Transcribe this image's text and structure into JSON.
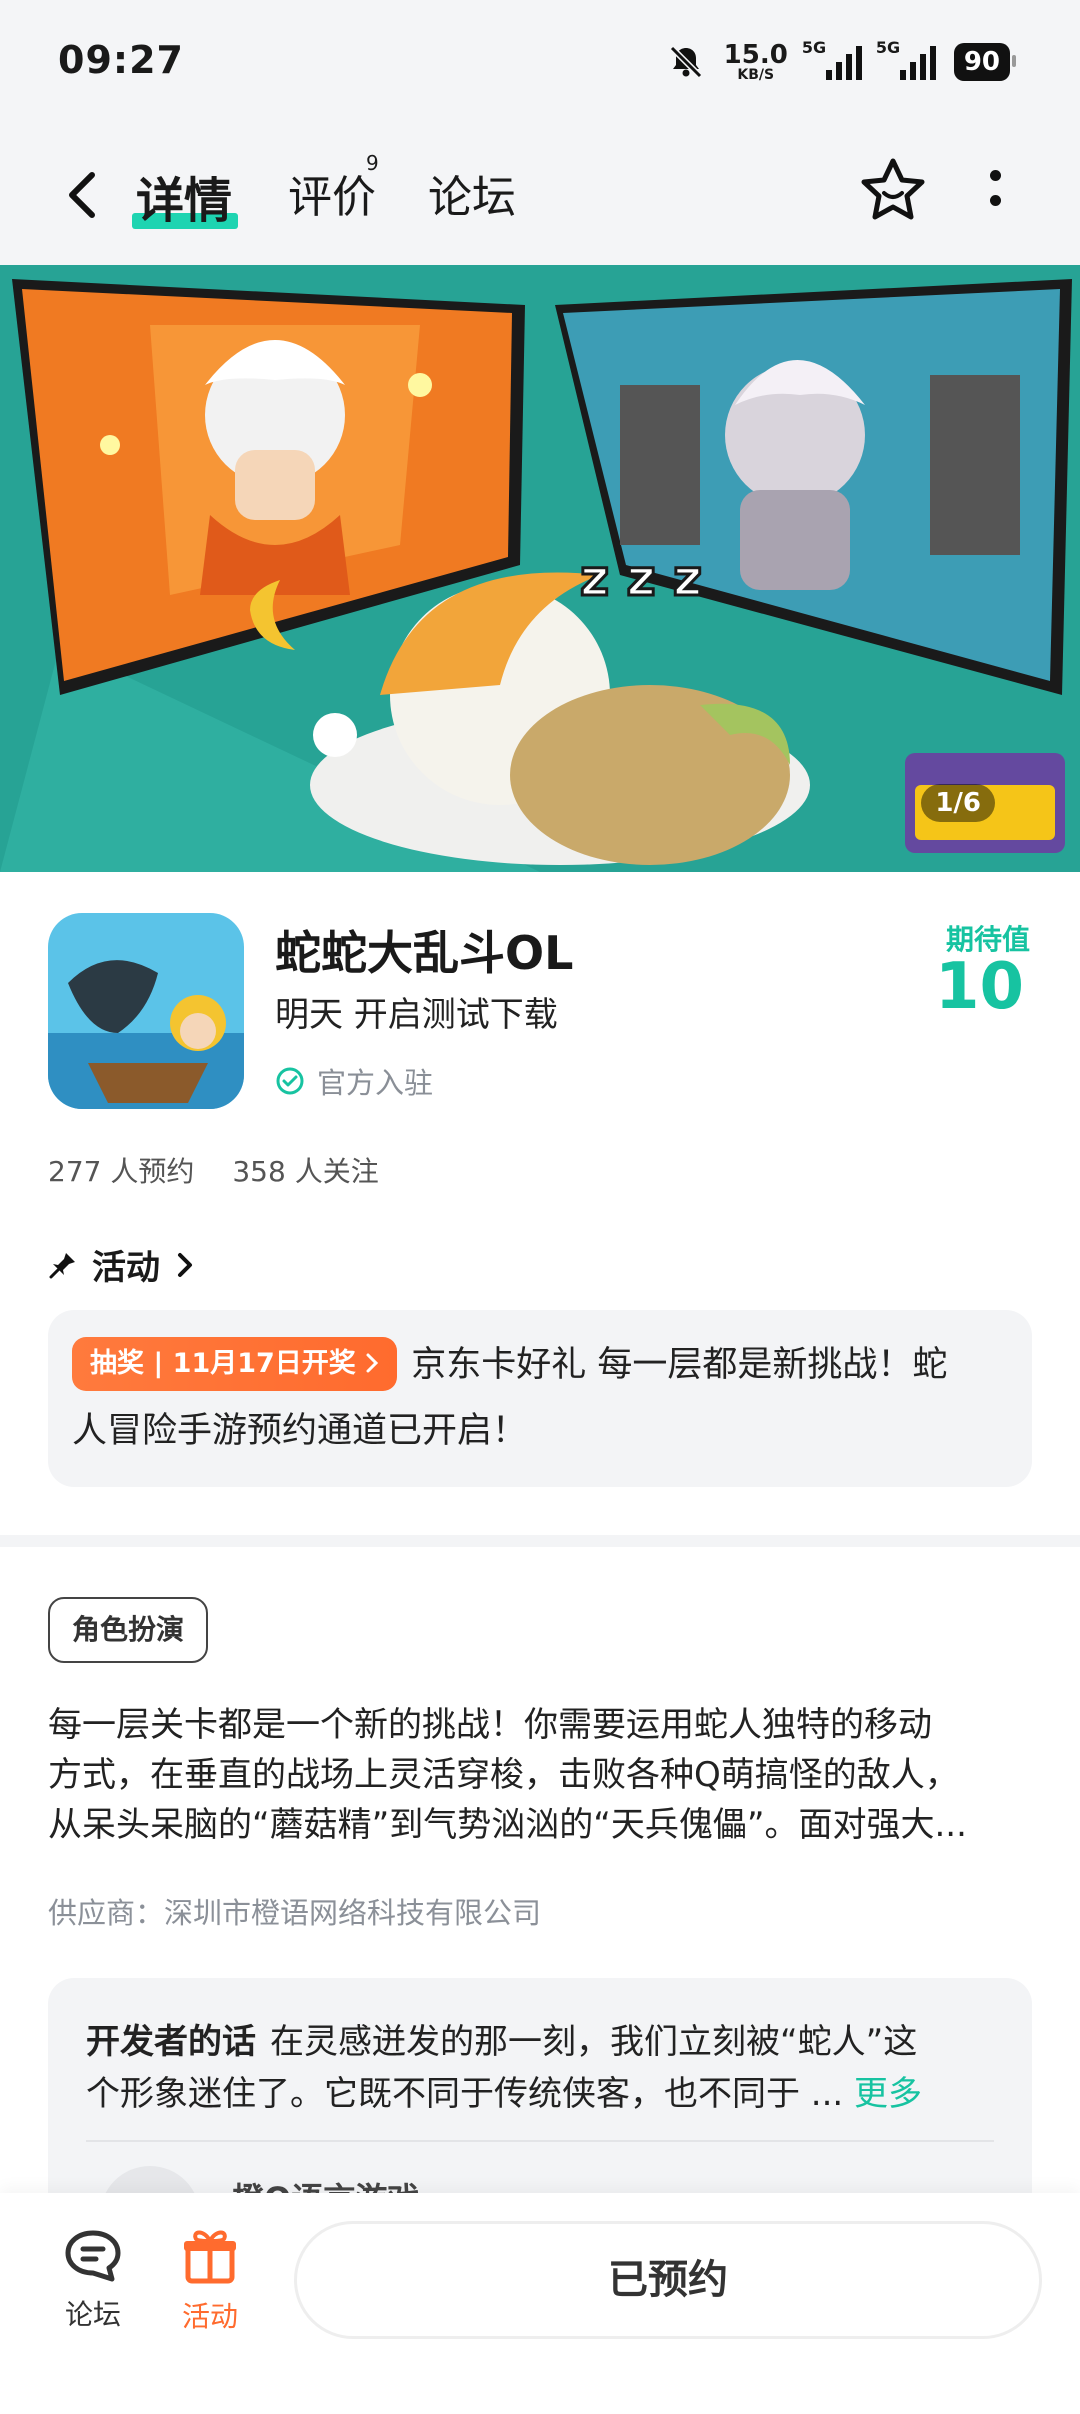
{
  "status_bar": {
    "time": "09:27",
    "net_speed": "15.0",
    "net_unit": "KB/S",
    "sig1_label": "5G",
    "sig2_label": "5G",
    "battery": "90"
  },
  "nav": {
    "tabs": [
      {
        "label": "详情"
      },
      {
        "label": "评价"
      },
      {
        "label": "论坛"
      }
    ],
    "review_badge": "9",
    "accent": "#1ed4b1"
  },
  "banner": {
    "counter": "1/6"
  },
  "game": {
    "title": "蛇蛇大乱斗OL",
    "subtitle": "明天 开启测试下载",
    "verified": "官方入驻",
    "expect_label": "期待值",
    "expect_value": "10",
    "reservations": "277 人预约",
    "followers": "358 人关注"
  },
  "activity": {
    "header": "活动",
    "badge": "抽奖 | 11月17日开奖 ",
    "text_line1": "京东卡好礼 每一层都是新挑战！蛇",
    "text_line2": "人冒险手游预约通道已开启！"
  },
  "details": {
    "genre": "角色扮演",
    "desc_lines": [
      "每一层关卡都是一个新的挑战！你需要运用蛇人独特的移动",
      "方式，在垂直的战场上灵活穿梭，击败各种Q萌搞怪的敌人，",
      "从呆头呆脑的“蘑菇精”到气势汹汹的“天兵傀儡”。面对强大..."
    ],
    "supplier": "供应商：深圳市橙语网络科技有限公司"
  },
  "developer": {
    "label": "开发者的话",
    "line1": "在灵感迸发的那一刻，我们立刻被“蛇人”这",
    "line2": "个形象迷住了。它既不同于传统侠客，也不同于 ...",
    "more": "更多",
    "name": "橙Q语言游戏"
  },
  "bottom_bar": {
    "forum": "论坛",
    "activity": "活动",
    "reserve": "已预约"
  }
}
